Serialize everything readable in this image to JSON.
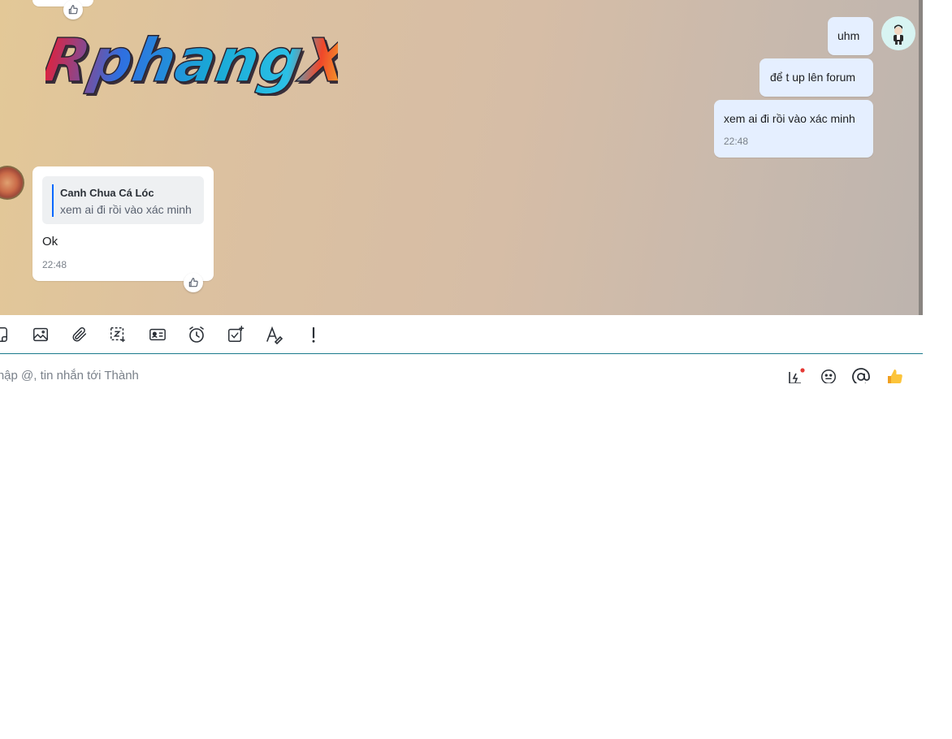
{
  "chat": {
    "logo_text": "RphangX",
    "outgoing": [
      {
        "text": "uhm"
      },
      {
        "text": "để t up lên forum"
      },
      {
        "text": "xem ai đi rồi vào xác minh",
        "time": "22:48"
      }
    ],
    "incoming": {
      "quote_name": "Canh Chua Cá Lóc",
      "quote_text": "xem ai đi rồi vào xác minh",
      "text": "Ok",
      "time": "22:48"
    }
  },
  "toolbar": {
    "icons": [
      "sticker-icon",
      "image-icon",
      "attachment-icon",
      "screenshot-icon",
      "contact-card-icon",
      "reminder-icon",
      "task-icon",
      "text-format-icon",
      "urgent-icon"
    ]
  },
  "composer": {
    "placeholder": "Nhập @, tin nhắn tới Thành",
    "icons": [
      "quick-message-icon",
      "emoji-icon",
      "mention-icon",
      "thumbs-up-send-icon"
    ]
  },
  "colors": {
    "outgoing_bubble": "#e5efff",
    "incoming_bubble": "#ffffff",
    "accent": "#0068ff",
    "divider": "#1a7a8c"
  }
}
